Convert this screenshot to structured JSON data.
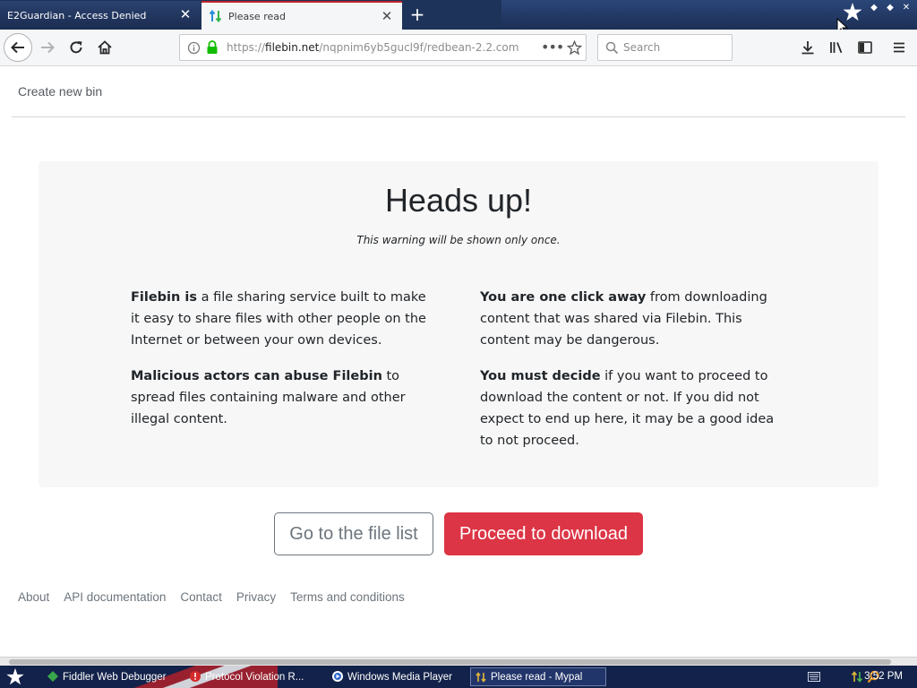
{
  "browser": {
    "tabs": [
      {
        "title": "E2Guardian - Access Denied",
        "active": false
      },
      {
        "title": "Please read",
        "active": true
      }
    ],
    "url": {
      "scheme": "https://",
      "host": "filebin.net",
      "path": "/nqpnim6yb5gucl9f/redbean-2.2.com"
    },
    "search_placeholder": "Search"
  },
  "page": {
    "create_link": "Create new bin",
    "heading": "Heads up!",
    "subheading": "This warning will be shown only once.",
    "left_col": [
      {
        "bold": "Filebin is",
        "rest": " a file sharing service built to make it easy to share files with other people on the Internet or between your own devices."
      },
      {
        "bold": "Malicious actors can abuse Filebin",
        "rest": " to spread files containing malware and other illegal content."
      }
    ],
    "right_col": [
      {
        "bold": "You are one click away",
        "rest": " from downloading content that was shared via Filebin. This content may be dangerous."
      },
      {
        "bold": "You must decide",
        "rest": " if you want to proceed to download the content or not. If you did not expect to end up here, it may be a good idea to not proceed."
      }
    ],
    "buttons": {
      "file_list": "Go to the file list",
      "proceed": "Proceed to download"
    },
    "footer_links": [
      "About",
      "API documentation",
      "Contact",
      "Privacy",
      "Terms and conditions"
    ]
  },
  "taskbar": {
    "items": [
      {
        "label": "Fiddler Web Debugger",
        "icon": "fiddler-icon"
      },
      {
        "label": "Protocol Violation R...",
        "icon": "warning-icon"
      },
      {
        "label": "Windows Media Player",
        "icon": "media-player-icon"
      },
      {
        "label": "Please read - Mypal",
        "icon": "mypal-icon",
        "active": true
      }
    ],
    "clock": "3:52 PM"
  },
  "colors": {
    "danger": "#dc3545",
    "secure_lock": "#12bc00",
    "tab_accent": "#c0262d"
  }
}
